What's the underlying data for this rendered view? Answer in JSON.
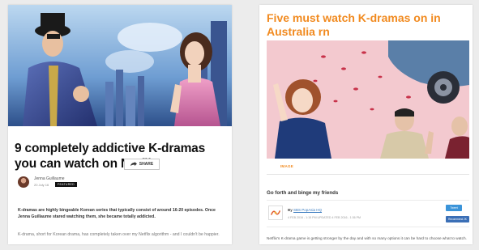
{
  "left_article": {
    "headline": "9 completely addictive K-dramas you can watch on Netflix",
    "share_label": "SHARE",
    "author_name": "Jenna Guillaume",
    "date": "20 July 16",
    "badge": "FEATURED",
    "lead_paragraph": "K-dramas are highly bingeable Korean series that typically consist of around 16-20 episodes. Once Jenna Guillaume stared watching them, she became totally addicted.",
    "body_paragraph": "K-drama, short for Korean drama, has completely taken over my Netflix algorithm - and I couldn't be happier."
  },
  "right_article": {
    "title": "Five must watch K-dramas on in Australia rn",
    "tabs": [
      "IMAGE",
      "",
      "",
      "",
      ""
    ],
    "section_heading": "Go forth and binge my friends",
    "byline_prefix": "By",
    "byline_source": "SBS PopAsia HQ",
    "byline_date": "4 FEB 2016 - 1:15 PM  UPDATED 4 FEB 2016 - 1:36 PM",
    "tweet_label": "Tweet",
    "recommend_label": "Recommend 2K",
    "paragraph": "Netflix's K-drama game is getting stronger by the day and with so many options it can be hard to choose what to watch."
  },
  "colors": {
    "accent_orange": "#f18a1f",
    "twitter_blue": "#3b94d9",
    "facebook_blue": "#3b6fb6"
  }
}
